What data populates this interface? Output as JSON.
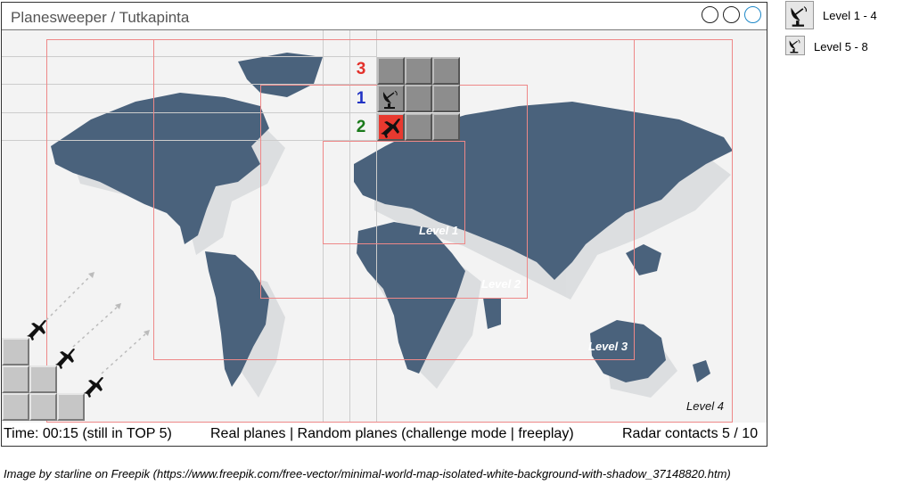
{
  "window": {
    "title": "Planesweeper / Tutkapinta"
  },
  "grid": {
    "row_hints": [
      "3",
      "1",
      "2"
    ],
    "row_hint_colors": [
      "#e3312b",
      "#2133c4",
      "#1a7a1a"
    ],
    "cells": [
      [
        "hidden",
        "hidden",
        "hidden"
      ],
      [
        "radar",
        "hidden",
        "hidden"
      ],
      [
        "plane-hit",
        "hidden",
        "hidden"
      ]
    ]
  },
  "map": {
    "levels": [
      "Level 1",
      "Level 2",
      "Level 3",
      "Level 4"
    ]
  },
  "status": {
    "time": "Time: 00:15 (still in TOP 5)",
    "modes": "Real planes | Random planes (challenge mode | freeplay)",
    "contacts": "Radar contacts 5 / 10"
  },
  "sidebar": {
    "buttons": [
      {
        "label": "Level 1 - 4",
        "icon": "radar-dish-icon"
      },
      {
        "label": "Level 5 - 8",
        "icon": "radar-dish-icon"
      }
    ]
  },
  "credit": "Image by starline on Freepik (https://www.freepik.com/free-vector/minimal-world-map-isolated-white-background-with-shadow_37148820.htm)",
  "colors": {
    "map_land": "#4a627c",
    "hit_cell": "#e8392f",
    "cell": "#8d8d8d"
  }
}
